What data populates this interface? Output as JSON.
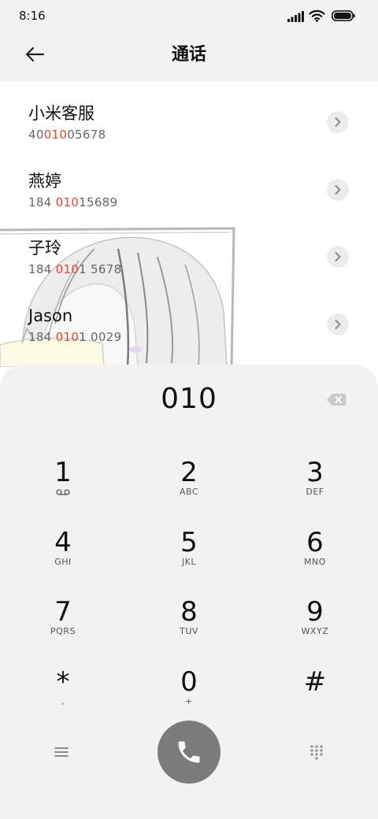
{
  "status_bar": {
    "time": "8:16",
    "icons": [
      "signal-icon",
      "wifi-icon",
      "battery-icon"
    ]
  },
  "header": {
    "title": "通话",
    "back_icon": "back-arrow-icon"
  },
  "contacts": [
    {
      "name": "小米客服",
      "number_prefix": "40",
      "number_match": "010",
      "number_suffix": "05678",
      "action_icon": "chevron-right-icon"
    },
    {
      "name": "燕婷",
      "number_prefix": "184 ",
      "number_match": "010",
      "number_suffix": "15689",
      "action_icon": "chevron-right-icon"
    },
    {
      "name": "子玲",
      "number_prefix": "184 ",
      "number_match": "010",
      "number_suffix": "1 5678",
      "action_icon": "chevron-right-icon"
    },
    {
      "name": "Jason",
      "number_prefix": "184 ",
      "number_match": "010",
      "number_suffix": "1 0029",
      "action_icon": "chevron-right-icon"
    }
  ],
  "dialpad": {
    "input": "010",
    "backspace_icon": "backspace-icon",
    "keys": [
      {
        "digit": "1",
        "sub": "",
        "icon": "voicemail-icon"
      },
      {
        "digit": "2",
        "sub": "ABC"
      },
      {
        "digit": "3",
        "sub": "DEF"
      },
      {
        "digit": "4",
        "sub": "GHI"
      },
      {
        "digit": "5",
        "sub": "JKL"
      },
      {
        "digit": "6",
        "sub": "MNO"
      },
      {
        "digit": "7",
        "sub": "PQRS"
      },
      {
        "digit": "8",
        "sub": "TUV"
      },
      {
        "digit": "9",
        "sub": "WXYZ"
      },
      {
        "digit": "*",
        "sub": ","
      },
      {
        "digit": "0",
        "sub": "+"
      },
      {
        "digit": "#",
        "sub": ""
      }
    ]
  },
  "bottom_bar": {
    "menu_icon": "menu-icon",
    "call_icon": "phone-icon",
    "dialpad_icon": "dialpad-icon"
  },
  "colors": {
    "match_highlight": "#e8452c",
    "call_button": "#7b7b7b",
    "dialpad_background": "#f3f2f0",
    "list_background": "#ffffff",
    "header_background": "#f2f2f2"
  }
}
